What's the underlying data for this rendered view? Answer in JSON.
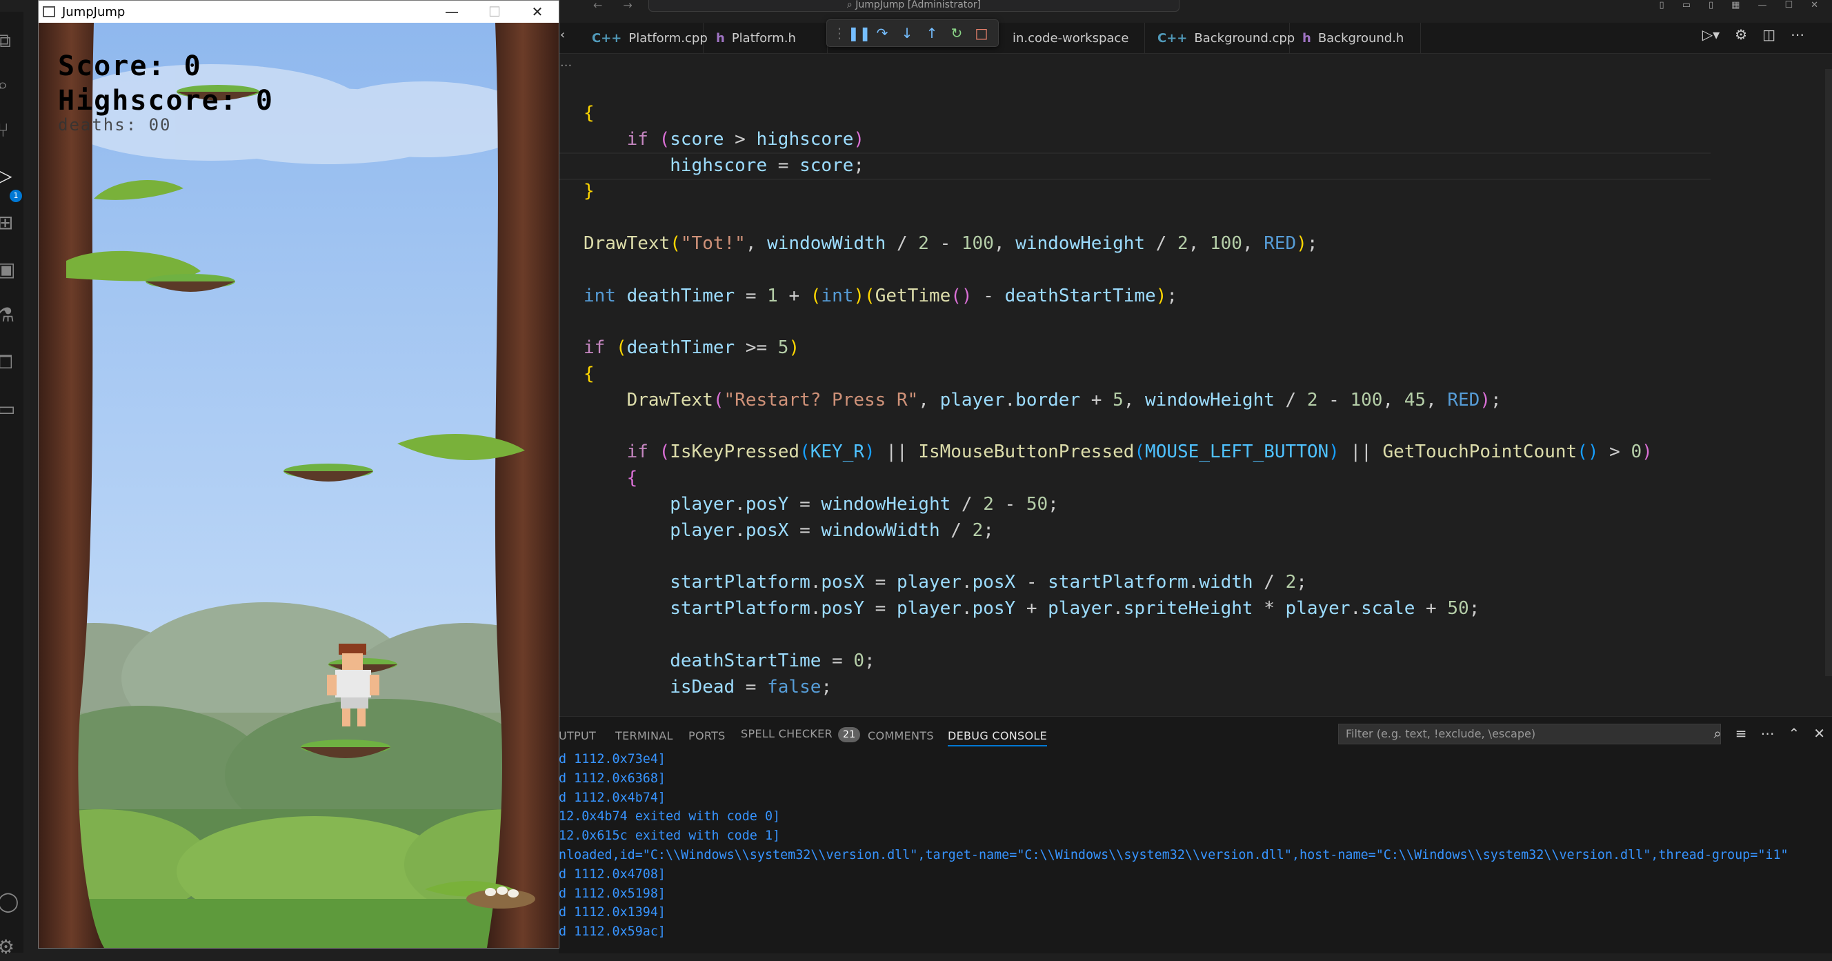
{
  "vscode": {
    "search_text": "JumpJump [Administrator]",
    "tabs": [
      {
        "label": "Platform.cpp",
        "kind": "cpp",
        "icon": "C++"
      },
      {
        "label": "Platform.h",
        "kind": "h",
        "icon": "h"
      },
      {
        "label": "in.code-workspace",
        "kind": "ws",
        "icon": ""
      },
      {
        "label": "Background.cpp",
        "kind": "cpp",
        "icon": "C++"
      },
      {
        "label": "Background.h",
        "kind": "h",
        "icon": "h"
      }
    ],
    "run_debug_badge": "1",
    "breadcrumb": "...",
    "code_lines": [
      [
        [
          "{",
          "t-p1"
        ]
      ],
      [
        [
          "    ",
          ""
        ],
        [
          "if",
          "t-ctl"
        ],
        [
          " ",
          ""
        ],
        [
          "(",
          "t-p2"
        ],
        [
          "score",
          "t-var"
        ],
        [
          " > ",
          ""
        ],
        [
          "highscore",
          "t-var"
        ],
        [
          ")",
          "t-p2"
        ]
      ],
      [
        [
          "        ",
          ""
        ],
        [
          "highscore",
          "t-var"
        ],
        [
          " = ",
          ""
        ],
        [
          "score",
          "t-var"
        ],
        [
          ";",
          ""
        ]
      ],
      [
        [
          "}",
          "t-p1"
        ]
      ],
      [
        [
          "",
          ""
        ]
      ],
      [
        [
          "DrawText",
          "t-fn"
        ],
        [
          "(",
          "t-p1"
        ],
        [
          "\"Tot!\"",
          "t-str"
        ],
        [
          ", ",
          ""
        ],
        [
          "windowWidth",
          "t-var"
        ],
        [
          " / ",
          ""
        ],
        [
          "2",
          "t-num"
        ],
        [
          " - ",
          ""
        ],
        [
          "100",
          "t-num"
        ],
        [
          ", ",
          ""
        ],
        [
          "windowHeight",
          "t-var"
        ],
        [
          " / ",
          ""
        ],
        [
          "2",
          "t-num"
        ],
        [
          ", ",
          ""
        ],
        [
          "100",
          "t-num"
        ],
        [
          ", ",
          ""
        ],
        [
          "RED",
          "t-macro"
        ],
        [
          ")",
          "t-p1"
        ],
        [
          ";",
          ""
        ]
      ],
      [
        [
          "",
          ""
        ]
      ],
      [
        [
          "int",
          "t-kw"
        ],
        [
          " ",
          ""
        ],
        [
          "deathTimer",
          "t-var"
        ],
        [
          " = ",
          ""
        ],
        [
          "1",
          "t-num"
        ],
        [
          " + ",
          ""
        ],
        [
          "(",
          "t-p1"
        ],
        [
          "int",
          "t-kw"
        ],
        [
          ")",
          "t-p1"
        ],
        [
          "(",
          "t-p1"
        ],
        [
          "GetTime",
          "t-fn"
        ],
        [
          "()",
          "t-p2"
        ],
        [
          " - ",
          ""
        ],
        [
          "deathStartTime",
          "t-var"
        ],
        [
          ")",
          "t-p1"
        ],
        [
          ";",
          ""
        ]
      ],
      [
        [
          "",
          ""
        ]
      ],
      [
        [
          "if",
          "t-ctl"
        ],
        [
          " ",
          ""
        ],
        [
          "(",
          "t-p1"
        ],
        [
          "deathTimer",
          "t-var"
        ],
        [
          " >= ",
          ""
        ],
        [
          "5",
          "t-num"
        ],
        [
          ")",
          "t-p1"
        ]
      ],
      [
        [
          "{",
          "t-p1"
        ]
      ],
      [
        [
          "    ",
          ""
        ],
        [
          "DrawText",
          "t-fn"
        ],
        [
          "(",
          "t-p2"
        ],
        [
          "\"Restart? Press R\"",
          "t-str"
        ],
        [
          ", ",
          ""
        ],
        [
          "player",
          "t-var"
        ],
        [
          ".",
          ""
        ],
        [
          "border",
          "t-var"
        ],
        [
          " + ",
          ""
        ],
        [
          "5",
          "t-num"
        ],
        [
          ", ",
          ""
        ],
        [
          "windowHeight",
          "t-var"
        ],
        [
          " / ",
          ""
        ],
        [
          "2",
          "t-num"
        ],
        [
          " - ",
          ""
        ],
        [
          "100",
          "t-num"
        ],
        [
          ", ",
          ""
        ],
        [
          "45",
          "t-num"
        ],
        [
          ", ",
          ""
        ],
        [
          "RED",
          "t-macro"
        ],
        [
          ")",
          "t-p2"
        ],
        [
          ";",
          ""
        ]
      ],
      [
        [
          "",
          ""
        ]
      ],
      [
        [
          "    ",
          ""
        ],
        [
          "if",
          "t-ctl"
        ],
        [
          " ",
          ""
        ],
        [
          "(",
          "t-p2"
        ],
        [
          "IsKeyPressed",
          "t-fn"
        ],
        [
          "(",
          "t-p3"
        ],
        [
          "KEY_R",
          "t-const"
        ],
        [
          ")",
          "t-p3"
        ],
        [
          " || ",
          ""
        ],
        [
          "IsMouseButtonPressed",
          "t-fn"
        ],
        [
          "(",
          "t-p3"
        ],
        [
          "MOUSE_LEFT_BUTTON",
          "t-const"
        ],
        [
          ")",
          "t-p3"
        ],
        [
          " || ",
          ""
        ],
        [
          "GetTouchPointCount",
          "t-fn"
        ],
        [
          "()",
          "t-p3"
        ],
        [
          " > ",
          ""
        ],
        [
          "0",
          "t-num"
        ],
        [
          ")",
          "t-p2"
        ]
      ],
      [
        [
          "    ",
          ""
        ],
        [
          "{",
          "t-p2"
        ]
      ],
      [
        [
          "        ",
          ""
        ],
        [
          "player",
          "t-var"
        ],
        [
          ".",
          ""
        ],
        [
          "posY",
          "t-var"
        ],
        [
          " = ",
          ""
        ],
        [
          "windowHeight",
          "t-var"
        ],
        [
          " / ",
          ""
        ],
        [
          "2",
          "t-num"
        ],
        [
          " - ",
          ""
        ],
        [
          "50",
          "t-num"
        ],
        [
          ";",
          ""
        ]
      ],
      [
        [
          "        ",
          ""
        ],
        [
          "player",
          "t-var"
        ],
        [
          ".",
          ""
        ],
        [
          "posX",
          "t-var"
        ],
        [
          " = ",
          ""
        ],
        [
          "windowWidth",
          "t-var"
        ],
        [
          " / ",
          ""
        ],
        [
          "2",
          "t-num"
        ],
        [
          ";",
          ""
        ]
      ],
      [
        [
          "",
          ""
        ]
      ],
      [
        [
          "        ",
          ""
        ],
        [
          "startPlatform",
          "t-var"
        ],
        [
          ".",
          ""
        ],
        [
          "posX",
          "t-var"
        ],
        [
          " = ",
          ""
        ],
        [
          "player",
          "t-var"
        ],
        [
          ".",
          ""
        ],
        [
          "posX",
          "t-var"
        ],
        [
          " - ",
          ""
        ],
        [
          "startPlatform",
          "t-var"
        ],
        [
          ".",
          ""
        ],
        [
          "width",
          "t-var"
        ],
        [
          " / ",
          ""
        ],
        [
          "2",
          "t-num"
        ],
        [
          ";",
          ""
        ]
      ],
      [
        [
          "        ",
          ""
        ],
        [
          "startPlatform",
          "t-var"
        ],
        [
          ".",
          ""
        ],
        [
          "posY",
          "t-var"
        ],
        [
          " = ",
          ""
        ],
        [
          "player",
          "t-var"
        ],
        [
          ".",
          ""
        ],
        [
          "posY",
          "t-var"
        ],
        [
          " + ",
          ""
        ],
        [
          "player",
          "t-var"
        ],
        [
          ".",
          ""
        ],
        [
          "spriteHeight",
          "t-var"
        ],
        [
          " * ",
          ""
        ],
        [
          "player",
          "t-var"
        ],
        [
          ".",
          ""
        ],
        [
          "scale",
          "t-var"
        ],
        [
          " + ",
          ""
        ],
        [
          "50",
          "t-num"
        ],
        [
          ";",
          ""
        ]
      ],
      [
        [
          "",
          ""
        ]
      ],
      [
        [
          "        ",
          ""
        ],
        [
          "deathStartTime",
          "t-var"
        ],
        [
          " = ",
          ""
        ],
        [
          "0",
          "t-num"
        ],
        [
          ";",
          ""
        ]
      ],
      [
        [
          "        ",
          ""
        ],
        [
          "isDead",
          "t-var"
        ],
        [
          " = ",
          ""
        ],
        [
          "false",
          "t-kw"
        ],
        [
          ";",
          ""
        ]
      ]
    ],
    "panel": {
      "tabs": [
        "UTPUT",
        "TERMINAL",
        "PORTS",
        "SPELL CHECKER",
        "COMMENTS",
        "DEBUG CONSOLE"
      ],
      "spell_checker_count": "21",
      "active_tab": "DEBUG CONSOLE",
      "filter_placeholder": "Filter (e.g. text, !exclude, \\escape)",
      "console_lines": [
        "d 1112.0x73e4]",
        "d 1112.0x6368]",
        "d 1112.0x4b74]",
        "12.0x4b74 exited with code 0]",
        "12.0x615c exited with code 1]",
        "nloaded,id=\"C:\\\\Windows\\\\system32\\\\version.dll\",target-name=\"C:\\\\Windows\\\\system32\\\\version.dll\",host-name=\"C:\\\\Windows\\\\system32\\\\version.dll\",thread-group=\"i1\"",
        "d 1112.0x4708]",
        "d 1112.0x5198]",
        "d 1112.0x1394]",
        "d 1112.0x59ac]"
      ]
    }
  },
  "game": {
    "window_title": "JumpJump",
    "hud": {
      "score": "Score: 0",
      "highscore": "Highscore: 0",
      "deaths": "deaths: 00"
    }
  }
}
